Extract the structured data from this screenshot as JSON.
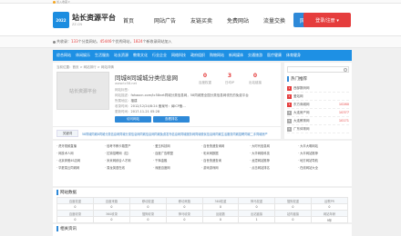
{
  "topbar": {
    "favorite": "加入收藏 ▾"
  },
  "header": {
    "logo_badge": "2022",
    "logo_title": "站长资源平台",
    "logo_sub": "ZZ.CN",
    "nav": [
      "首页",
      "网站广告",
      "友链买卖",
      "免费网站",
      "流量交换",
      "网站排行"
    ],
    "nav_active_index": 5,
    "login_label": "登录/注册 ▾"
  },
  "notice": {
    "prefix": "共收录：",
    "count1": "133",
    "mid1": "个分类网站，",
    "count2": "45446",
    "mid2": "个优秀网站，",
    "count3": "1824",
    "suffix": "个新收录网站加入"
  },
  "categories": [
    "综合网站",
    "休闲娱乐",
    "生活服务",
    "站长资源",
    "教育文化",
    "行业企业",
    "网络科技",
    "政府组织",
    "购物网站",
    "新闻媒体",
    "交通旅游",
    "医疗健康",
    "体育健身"
  ],
  "breadcrumb": "当前位置：首页 > 网站排行 > 网站详情",
  "site": {
    "thumb_text": "站长资源平台",
    "title": "同城8同城城分类信息网",
    "url": "www.tc58.net",
    "stats": [
      {
        "num": "0",
        "label": "百度权重"
      },
      {
        "num": "3",
        "label": "日均IP"
      },
      {
        "num": "0",
        "label": "出站链接"
      }
    ],
    "info": [
      {
        "label": "网站标签：",
        "value": ""
      },
      {
        "label": "网站描述：",
        "value": "fahaocn.com/tc58net同城分类信息网，58同城是全国分类信息网领先的免费平台"
      },
      {
        "label": "所属地区：",
        "value": "福建"
      },
      {
        "label": "收录时间：",
        "value": "2012/12/24/8:24 备案号：闽ICP备..."
      },
      {
        "label": "更新时间：",
        "value": "2017-11-21 05:28"
      }
    ],
    "visit_btn": "访问网站",
    "rank_btn": "查看排名"
  },
  "keywords": {
    "label": "关键词",
    "text": "58同城同城8同城分类信息网同城分类信息网同城信息网同城免费发布信息网同城服务网同城便民信息网同城生活服务同城招聘同城二手同城房产"
  },
  "sidebar": {
    "search_placeholder": "",
    "title": "热门推荐",
    "items": [
      {
        "rank": "1",
        "name": "西部数码网",
        "num": ""
      },
      {
        "rank": "2",
        "name": "爱站网",
        "num": ""
      },
      {
        "rank": "3",
        "name": "东方商城网",
        "num": "10260"
      },
      {
        "rank": "4",
        "name": "大连房产网",
        "num": "10377"
      },
      {
        "rank": "5",
        "name": "大连教育网",
        "num": "10171"
      },
      {
        "rank": "6",
        "name": "广东体育网",
        "num": ""
      },
      {
        "rank": "7",
        "name": "广告出租网",
        "num": ""
      }
    ]
  },
  "links": [
    "· 虎牙视频直播",
    "· 信考不教卡路里产",
    "· 爱玉科技网",
    "· 百世快递查询网",
    "· 大时代信息网",
    "· 大丰大明网站",
    "· 网技术人网",
    "· 拉钩招聘网（拉）",
    "· 百度广告联盟",
    "· 彩米网数据",
    "· 大华网络科技",
    "· 大丰网站推荐",
    "· 北京奔驰4S店网",
    "· 米米网综合人才网",
    "· 千辉金融",
    "· 百世快递查询",
    "· 龙潭网站推荐",
    "· 地方网站导航",
    "· 华夏易云同城网",
    "· 易龙英语在线",
    "· 深度百度网",
    "· 游戏游戏网",
    "· 点击网站排名",
    "· 在线网站大全"
  ],
  "data_section": {
    "title": "网站数据",
    "header1": [
      "百度权重",
      "百度来路",
      "移动权重",
      "移动来路",
      "360权重",
      "神马权重",
      "搜狗权重",
      "谷歌PR"
    ],
    "row1": [
      "0",
      "0",
      "0",
      "0",
      "0",
      "0",
      "0",
      "0"
    ],
    "header2": [
      "百度收录",
      "360收录",
      "搜狗收录",
      "神马收录",
      "反链数",
      "出站链接",
      "站内链接",
      "网站年龄"
    ],
    "row2": [
      "0",
      "0",
      "0",
      "0",
      "0",
      "1",
      "0",
      "9年"
    ]
  },
  "trend_section": {
    "title": "相关资讯"
  }
}
